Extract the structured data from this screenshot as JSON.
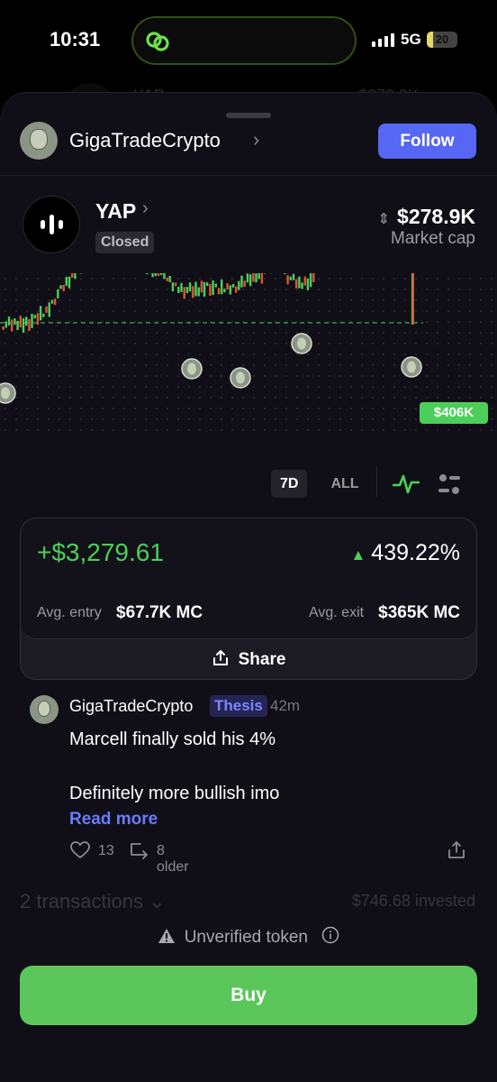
{
  "status_bar": {
    "time": "10:31",
    "network": "5G",
    "battery": "20"
  },
  "behind": {
    "name": "YAP",
    "value": "$278.9K"
  },
  "header": {
    "username": "GigaTradeCrypto",
    "follow_label": "Follow"
  },
  "token": {
    "name": "YAP",
    "status": "Closed",
    "market_cap": "$278.9K",
    "market_cap_label": "Market cap"
  },
  "chart": {
    "price_tag": "$406K"
  },
  "chart_data": {
    "type": "line",
    "description_series": [
      {
        "name": "",
        "values": [
          60,
          64,
          70,
          90,
          130,
          160,
          200,
          260,
          300,
          290,
          250,
          210,
          190,
          180,
          150,
          140,
          135,
          150,
          138,
          145,
          150,
          170,
          180,
          210,
          170,
          150,
          160,
          220,
          240,
          240,
          240,
          406
        ]
      }
    ]
  },
  "periods": [
    {
      "label": "7D",
      "active": true
    },
    {
      "label": "ALL",
      "active": false
    }
  ],
  "pnl": {
    "gain": "+$3,279.61",
    "percent": "439.22%",
    "entry_label": "Avg. entry",
    "entry_value": "$67.7K MC",
    "exit_label": "Avg. exit",
    "exit_value": "$365K MC",
    "share_label": "Share"
  },
  "post": {
    "author": "GigaTradeCrypto",
    "tag": "Thesis",
    "ago": "42m",
    "body": "Marcell finally sold his 4%\n\nDefinitely more bullish imo",
    "read_more": "Read more",
    "likes": "13",
    "older": "8 older"
  },
  "transactions": {
    "count_label": "2 transactions",
    "invested": "$746.68 invested"
  },
  "warning": {
    "label": "Unverified token"
  },
  "buy": {
    "label": "Buy"
  },
  "colors": {
    "green": "#4ccf5a",
    "accent": "#5667f5",
    "red": "#e0533a"
  }
}
